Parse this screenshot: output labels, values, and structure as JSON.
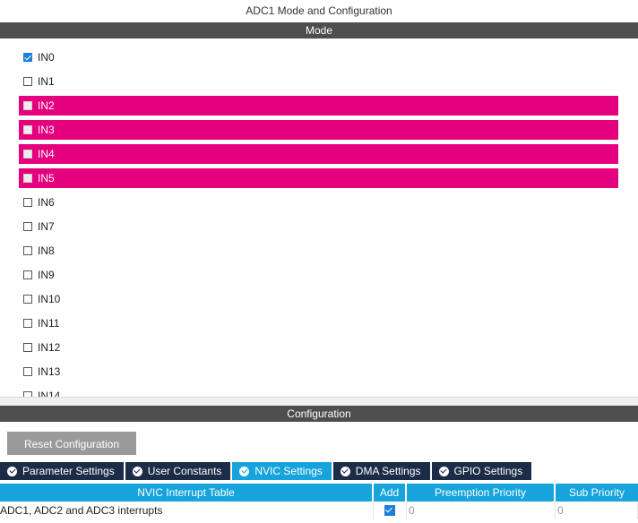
{
  "window_title": "ADC1 Mode and Configuration",
  "mode": {
    "header": "Mode",
    "items": [
      {
        "label": "IN0",
        "checked": true,
        "highlighted": false
      },
      {
        "label": "IN1",
        "checked": false,
        "highlighted": false
      },
      {
        "label": "IN2",
        "checked": false,
        "highlighted": true
      },
      {
        "label": "IN3",
        "checked": false,
        "highlighted": true
      },
      {
        "label": "IN4",
        "checked": false,
        "highlighted": true
      },
      {
        "label": "IN5",
        "checked": false,
        "highlighted": true
      },
      {
        "label": "IN6",
        "checked": false,
        "highlighted": false
      },
      {
        "label": "IN7",
        "checked": false,
        "highlighted": false
      },
      {
        "label": "IN8",
        "checked": false,
        "highlighted": false
      },
      {
        "label": "IN9",
        "checked": false,
        "highlighted": false
      },
      {
        "label": "IN10",
        "checked": false,
        "highlighted": false
      },
      {
        "label": "IN11",
        "checked": false,
        "highlighted": false
      },
      {
        "label": "IN12",
        "checked": false,
        "highlighted": false
      },
      {
        "label": "IN13",
        "checked": false,
        "highlighted": false
      },
      {
        "label": "IN14",
        "checked": false,
        "highlighted": false
      }
    ]
  },
  "configuration": {
    "header": "Configuration",
    "reset_label": "Reset Configuration",
    "tabs": [
      {
        "label": "Parameter Settings",
        "active": false
      },
      {
        "label": "User Constants",
        "active": false
      },
      {
        "label": "NVIC Settings",
        "active": true
      },
      {
        "label": "DMA Settings",
        "active": false
      },
      {
        "label": "GPIO Settings",
        "active": false
      }
    ]
  },
  "nvic_table": {
    "columns": [
      "NVIC Interrupt Table",
      "Add",
      "Preemption Priority",
      "Sub Priority"
    ],
    "rows": [
      {
        "name": "ADC1, ADC2 and ADC3 interrupts",
        "add": true,
        "preemption": "0",
        "sub": "0"
      }
    ]
  },
  "colors": {
    "highlight": "#e5007e",
    "section_bar": "#4e4e4e",
    "tab_dark": "#1c2b46",
    "tab_active": "#17a3dc",
    "checkbox_checked": "#1f7fd4"
  },
  "icons": {
    "tab_check": "check-circle-icon",
    "checkbox": "checkbox-icon"
  }
}
